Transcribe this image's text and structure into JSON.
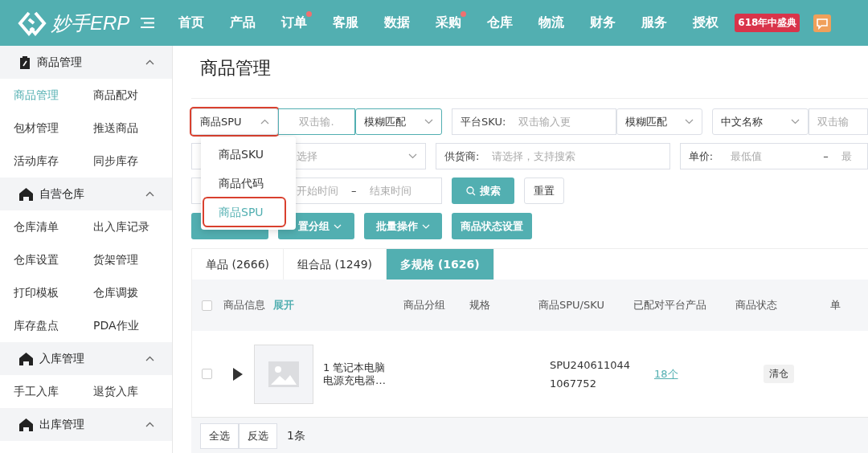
{
  "topbar": {
    "logo": "妙手ERP",
    "nav": [
      {
        "label": "首页",
        "dot": false
      },
      {
        "label": "产品",
        "dot": false
      },
      {
        "label": "订单",
        "dot": true
      },
      {
        "label": "客服",
        "dot": false
      },
      {
        "label": "数据",
        "dot": false
      },
      {
        "label": "采购",
        "dot": true
      },
      {
        "label": "仓库",
        "dot": false
      },
      {
        "label": "物流",
        "dot": false
      },
      {
        "label": "财务",
        "dot": false
      },
      {
        "label": "服务",
        "dot": false
      },
      {
        "label": "授权",
        "dot": false
      }
    ],
    "promo": "618年中盛典"
  },
  "sidebar": [
    {
      "title": "商品管理",
      "expanded": true,
      "items": [
        {
          "label": "商品管理",
          "selected": true
        },
        {
          "label": "商品配对",
          "selected": false
        },
        {
          "label": "包材管理",
          "selected": false
        },
        {
          "label": "推送商品",
          "selected": false
        },
        {
          "label": "活动库存",
          "selected": false
        },
        {
          "label": "同步库存",
          "selected": false
        }
      ]
    },
    {
      "title": "自营仓库",
      "expanded": true,
      "items": [
        {
          "label": "仓库清单",
          "selected": false
        },
        {
          "label": "出入库记录",
          "selected": false
        },
        {
          "label": "仓库设置",
          "selected": false
        },
        {
          "label": "货架管理",
          "selected": false
        },
        {
          "label": "打印模板",
          "selected": false
        },
        {
          "label": "仓库调拨",
          "selected": false
        },
        {
          "label": "库存盘点",
          "selected": false
        },
        {
          "label": "PDA作业",
          "selected": false
        }
      ]
    },
    {
      "title": "入库管理",
      "expanded": true,
      "items": [
        {
          "label": "手工入库",
          "selected": false
        },
        {
          "label": "退货入库",
          "selected": false
        }
      ]
    },
    {
      "title": "出库管理",
      "expanded": true
    }
  ],
  "page_title": "商品管理",
  "filters": {
    "row1": {
      "field_type": "商品SPU",
      "input_placeholder": "双击输.",
      "match": "模糊匹配",
      "sku_label": "平台SKU:",
      "sku_placeholder": "双击输入更",
      "sku_match": "模糊匹配",
      "name_type": "中文名称",
      "name_placeholder": "双击输"
    },
    "row2": {
      "group_placeholder": "选择",
      "supplier_label": "供货商:",
      "supplier_placeholder": "请选择，支持搜索",
      "price_label": "单价:",
      "price_min": "最低值",
      "dash": "–",
      "price_max": "最"
    },
    "row3": {
      "start": "开始时间",
      "dash": "–",
      "end": "结束时间",
      "search": "搜索",
      "reset": "重置"
    }
  },
  "dropdown": [
    {
      "label": "商品SKU",
      "selected": false
    },
    {
      "label": "商品代码",
      "selected": false
    },
    {
      "label": "商品SPU",
      "selected": true
    }
  ],
  "actions": [
    {
      "label": "置分组",
      "caret": true
    },
    {
      "label": "批量操作",
      "caret": true
    },
    {
      "label": "商品状态设置",
      "caret": false
    }
  ],
  "tabs": [
    {
      "label": "单品 (2666)",
      "selected": false
    },
    {
      "label": "组合品 (1249)",
      "selected": false
    },
    {
      "label": "多规格 (1626)",
      "selected": true
    }
  ],
  "table": {
    "header_checked": false,
    "columns": [
      "商品信息",
      "商品分组",
      "规格",
      "商品SPU/SKU",
      "已配对平台产品",
      "商品状态",
      "单"
    ],
    "expand_link": "展开",
    "rows": [
      {
        "checked": false,
        "name": "1 笔记本电脑电源充电器…",
        "spu": "SPU240611044\n1067752",
        "paired": "18个",
        "status": "清仓"
      }
    ]
  },
  "footer": {
    "select_all": "全选",
    "invert": "反选",
    "count": "1条"
  }
}
